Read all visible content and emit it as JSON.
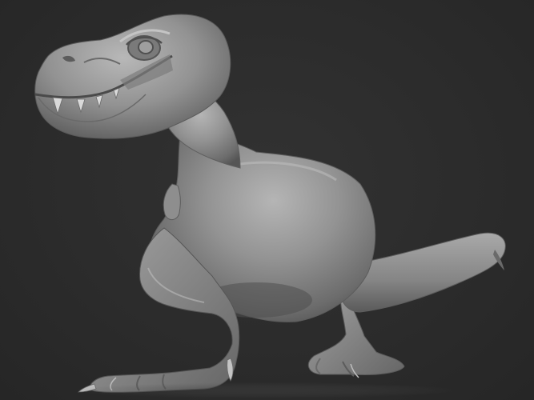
{
  "viewport": {
    "background_color": "#2d2d2d",
    "model_color": "#8a8a8a",
    "subject_icon": "dinosaur-sculpt-icon"
  }
}
